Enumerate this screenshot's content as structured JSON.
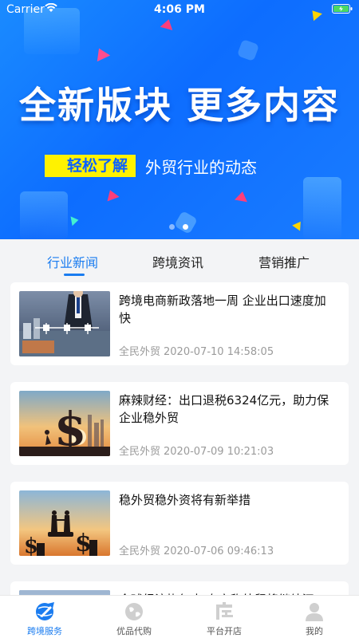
{
  "status_bar": {
    "carrier": "Carrier",
    "time": "4:06 PM"
  },
  "banner": {
    "headline": "全新版块 更多内容",
    "highlight": "轻松了解",
    "subtext": "外贸行业的动态",
    "slide_index": 2,
    "slide_count": 2
  },
  "tabs": [
    {
      "label": "行业新闻",
      "active": true
    },
    {
      "label": "跨境资讯",
      "active": false
    },
    {
      "label": "营销推广",
      "active": false
    }
  ],
  "articles": [
    {
      "title": "跨境电商新政落地一周 企业出口速度加快",
      "source": "全民外贸",
      "date": "2020-07-10 14:58:05",
      "image": "businessman-network-image"
    },
    {
      "title": "麻辣财经：出口退税6324亿元，助力保企业稳外贸",
      "source": "全民外贸",
      "date": "2020-07-09 10:21:03",
      "image": "dollar-sign-sunset-image"
    },
    {
      "title": "稳外贸稳外资将有新举措",
      "source": "全民外贸",
      "date": "2020-07-06 09:46:13",
      "image": "handshake-coins-image"
    },
    {
      "title": "全球经济恢复中 专家称外贸将继续添",
      "source": "",
      "date": "",
      "image": "globe-image"
    }
  ],
  "tabbar": [
    {
      "label": "跨境服务",
      "icon": "plane-globe-icon",
      "active": true
    },
    {
      "label": "优品代购",
      "icon": "globe-icon",
      "active": false
    },
    {
      "label": "平台开店",
      "icon": "store-icon",
      "active": false
    },
    {
      "label": "我的",
      "icon": "user-icon",
      "active": false
    }
  ],
  "colors": {
    "accent": "#1a7cf0",
    "banner": "#0d6dff",
    "highlight": "#fff200"
  }
}
